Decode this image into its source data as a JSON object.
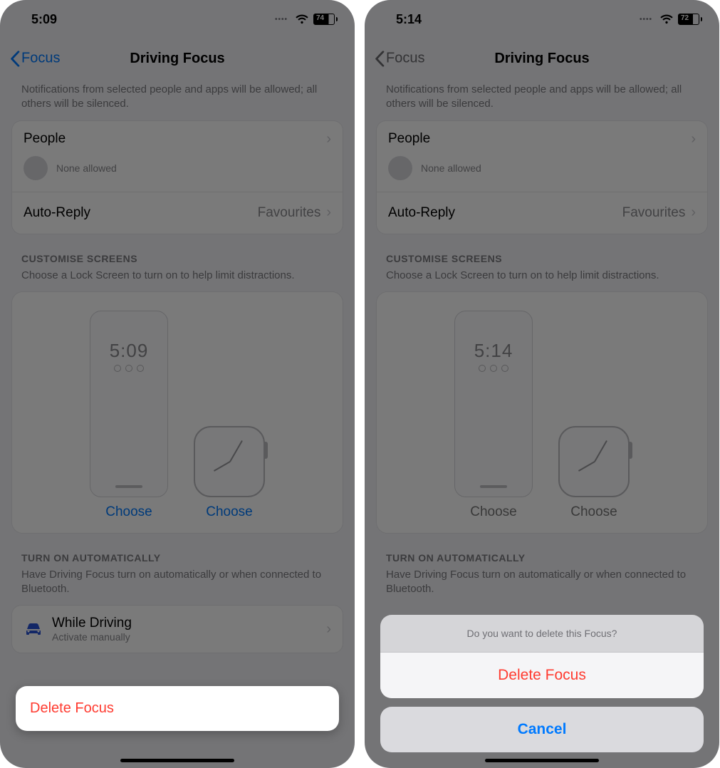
{
  "left": {
    "status": {
      "time": "5:09",
      "battery": "74"
    },
    "nav": {
      "back": "Focus",
      "title": "Driving Focus"
    },
    "notif_note": "Notifications from selected people and apps will be allowed; all others will be silenced.",
    "people": {
      "label": "People",
      "sub": "None allowed"
    },
    "autoreply": {
      "label": "Auto-Reply",
      "value": "Favourites"
    },
    "screens": {
      "header": "CUSTOMISE SCREENS",
      "sub": "Choose a Lock Screen to turn on to help limit distractions.",
      "lock_time": "5:09",
      "choose1": "Choose",
      "choose2": "Choose"
    },
    "auto": {
      "header": "TURN ON AUTOMATICALLY",
      "sub": "Have Driving Focus turn on automatically or when connected to Bluetooth.",
      "row_title": "While Driving",
      "row_sub": "Activate manually"
    },
    "delete": "Delete Focus"
  },
  "right": {
    "status": {
      "time": "5:14",
      "battery": "72"
    },
    "nav": {
      "back": "Focus",
      "title": "Driving Focus"
    },
    "notif_note": "Notifications from selected people and apps will be allowed; all others will be silenced.",
    "people": {
      "label": "People",
      "sub": "None allowed"
    },
    "autoreply": {
      "label": "Auto-Reply",
      "value": "Favourites"
    },
    "screens": {
      "header": "CUSTOMISE SCREENS",
      "sub": "Choose a Lock Screen to turn on to help limit distractions.",
      "lock_time": "5:14",
      "choose1": "Choose",
      "choose2": "Choose"
    },
    "auto": {
      "header": "TURN ON AUTOMATICALLY",
      "sub": "Have Driving Focus turn on automatically or when connected to Bluetooth."
    },
    "sheet": {
      "prompt": "Do you want to delete this Focus?",
      "delete": "Delete Focus",
      "cancel": "Cancel"
    }
  }
}
